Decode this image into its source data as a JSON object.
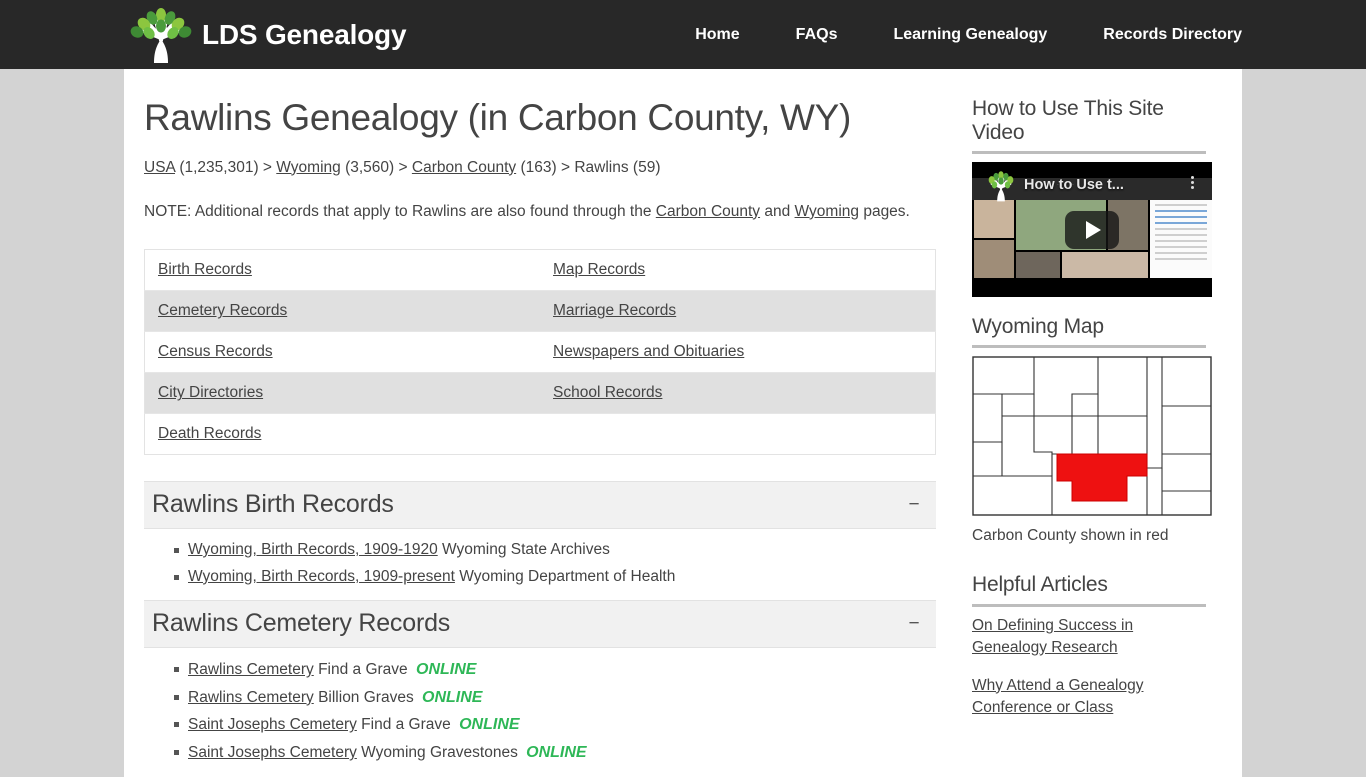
{
  "header": {
    "brand_name": "LDS Genealogy",
    "logo_icon": "tree-logo-icon",
    "nav": [
      {
        "label": "Home"
      },
      {
        "label": "FAQs"
      },
      {
        "label": "Learning Genealogy"
      },
      {
        "label": "Records Directory"
      }
    ]
  },
  "main": {
    "page_title": "Rawlins Genealogy (in Carbon County, WY)",
    "breadcrumb": {
      "usa_label": "USA",
      "usa_count": "(1,235,301)",
      "sep1": ">",
      "wyoming_label": "Wyoming",
      "wyoming_count": "(3,560)",
      "sep2": ">",
      "county_label": "Carbon County",
      "county_count": "(163)",
      "sep3": ">",
      "city_label": "Rawlins",
      "city_count": "(59)"
    },
    "note": {
      "prefix": "NOTE: Additional records that apply to Rawlins are also found through the ",
      "link1": "Carbon County",
      "middle": " and ",
      "link2": "Wyoming",
      "suffix": " pages."
    },
    "records_table": [
      {
        "left": "Birth Records",
        "right": "Map Records"
      },
      {
        "left": "Cemetery Records",
        "right": "Marriage Records"
      },
      {
        "left": "Census Records",
        "right": "Newspapers and Obituaries"
      },
      {
        "left": "City Directories",
        "right": "School Records"
      },
      {
        "left": "Death Records",
        "right": ""
      }
    ],
    "sections": [
      {
        "title": "Rawlins Birth Records",
        "toggle": "−",
        "items": [
          {
            "link": "Wyoming, Birth Records, 1909-1920",
            "source": "Wyoming State Archives",
            "online": ""
          },
          {
            "link": "Wyoming, Birth Records, 1909-present",
            "source": "Wyoming Department of Health",
            "online": ""
          }
        ]
      },
      {
        "title": "Rawlins Cemetery Records",
        "toggle": "−",
        "items": [
          {
            "link": "Rawlins Cemetery",
            "source": "Find a Grave",
            "online": "ONLINE"
          },
          {
            "link": "Rawlins Cemetery",
            "source": "Billion Graves",
            "online": "ONLINE"
          },
          {
            "link": "Saint Josephs Cemetery",
            "source": "Find a Grave",
            "online": "ONLINE"
          },
          {
            "link": "Saint Josephs Cemetery",
            "source": "Wyoming Gravestones",
            "online": "ONLINE"
          }
        ]
      }
    ]
  },
  "sidebar": {
    "video_widget": {
      "heading": "How to Use This Site Video",
      "overlay_title": "How to Use t...",
      "play_icon": "play-button-icon",
      "menu_icon": "kebab-menu-icon"
    },
    "map_widget": {
      "heading": "Wyoming Map",
      "caption": "Carbon County shown in red",
      "highlight_color": "#ee1111"
    },
    "articles_widget": {
      "heading": "Helpful Articles",
      "links": [
        "On Defining Success in Genealogy Research",
        "Why Attend a Genealogy Conference or Class"
      ]
    }
  },
  "colors": {
    "header_bg": "#282828",
    "page_bg": "#d3d3d3",
    "online_green": "#2eb757",
    "section_bg": "#f1f1f1",
    "table_alt_row": "#e0e0e0"
  }
}
